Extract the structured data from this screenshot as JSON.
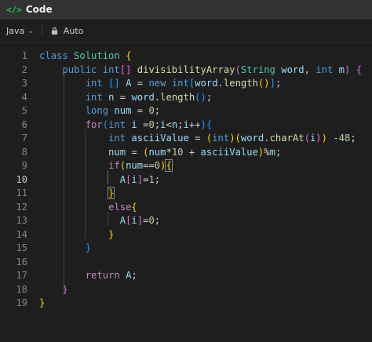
{
  "titlebar": {
    "icon": "code-brackets-icon",
    "title": "Code"
  },
  "toolbar": {
    "language": "Java",
    "lock_icon": "lock-icon",
    "mode": "Auto"
  },
  "editor": {
    "active_line": 10,
    "lines": [
      {
        "n": "1",
        "text": "class Solution {"
      },
      {
        "n": "2",
        "text": "    public int[] divisibilityArray(String word, int m) {"
      },
      {
        "n": "3",
        "text": "        int [] A = new int[word.length()];"
      },
      {
        "n": "4",
        "text": "        int n = word.length();"
      },
      {
        "n": "5",
        "text": "        long num = 0;"
      },
      {
        "n": "6",
        "text": "        for(int i =0;i<n;i++){"
      },
      {
        "n": "7",
        "text": "            int asciiValue = (int)(word.charAt(i)) -48;"
      },
      {
        "n": "8",
        "text": "            num = (num*10 + asciiValue)%m;"
      },
      {
        "n": "9",
        "text": "            if(num==0){"
      },
      {
        "n": "10",
        "text": "              A[i]=1;"
      },
      {
        "n": "11",
        "text": "            }"
      },
      {
        "n": "12",
        "text": "            else{"
      },
      {
        "n": "13",
        "text": "              A[i]=0;"
      },
      {
        "n": "14",
        "text": "            }"
      },
      {
        "n": "15",
        "text": "        }"
      },
      {
        "n": "16",
        "text": ""
      },
      {
        "n": "17",
        "text": "        return A;"
      },
      {
        "n": "18",
        "text": "    }"
      },
      {
        "n": "19",
        "text": "}"
      }
    ]
  }
}
